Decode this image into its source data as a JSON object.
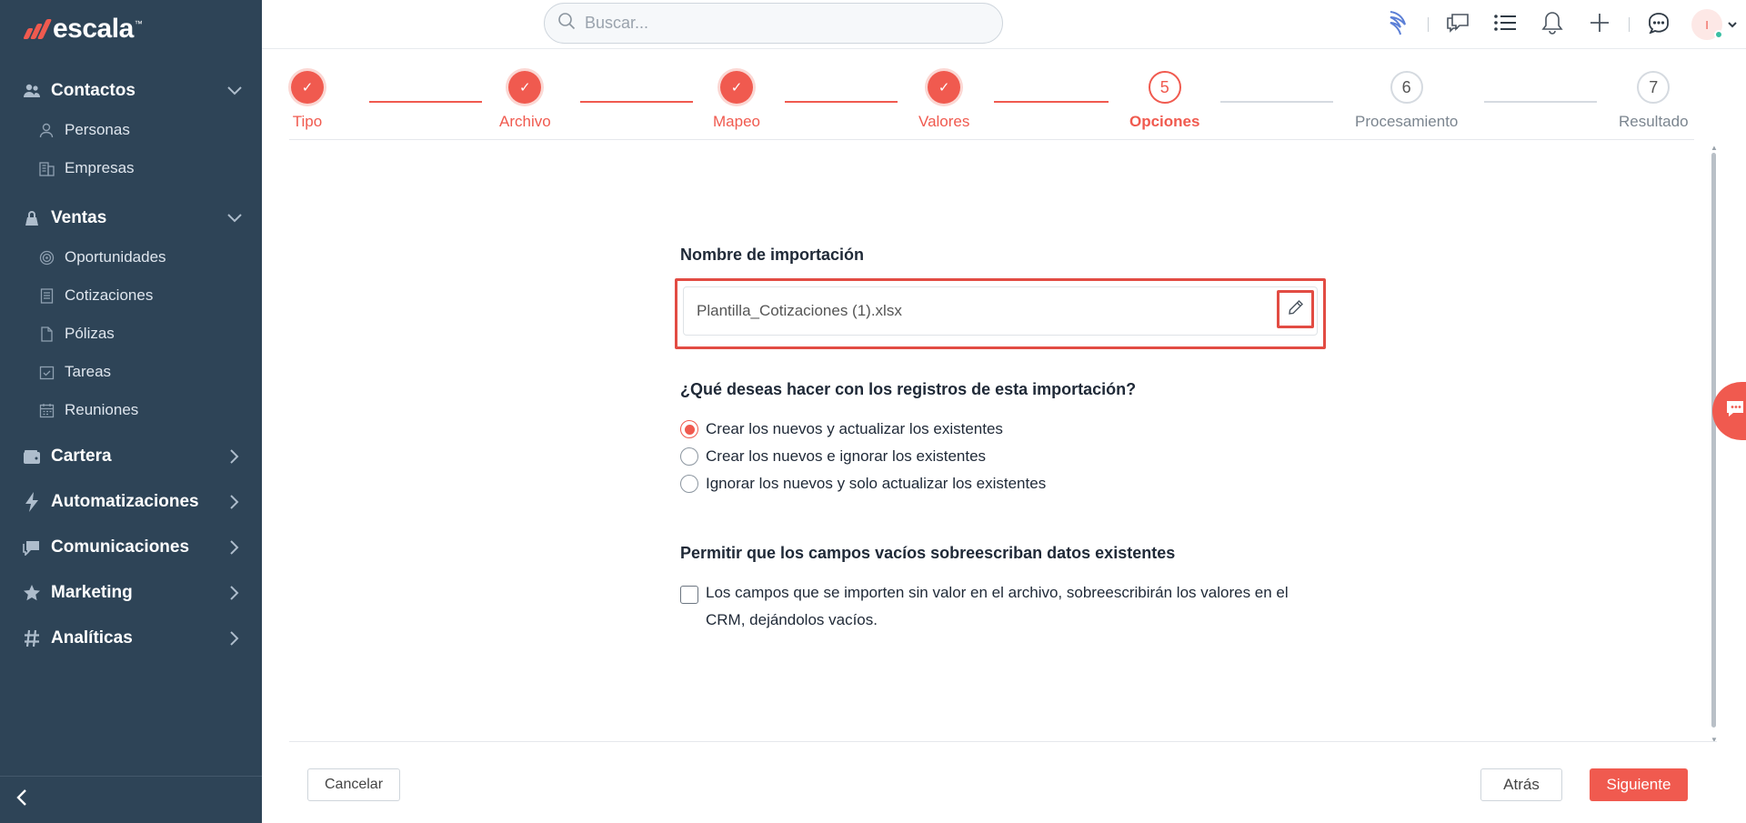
{
  "app": {
    "logo_text": "escala",
    "logo_tm": "™"
  },
  "sidebar": {
    "sections": [
      {
        "label": "Contactos",
        "icon": "contacts-icon",
        "expanded": true,
        "items": [
          {
            "label": "Personas",
            "icon": "person-icon"
          },
          {
            "label": "Empresas",
            "icon": "building-icon"
          }
        ]
      },
      {
        "label": "Ventas",
        "icon": "sales-icon",
        "expanded": true,
        "items": [
          {
            "label": "Oportunidades",
            "icon": "target-icon"
          },
          {
            "label": "Cotizaciones",
            "icon": "document-icon"
          },
          {
            "label": "Pólizas",
            "icon": "file-icon"
          },
          {
            "label": "Tareas",
            "icon": "task-icon"
          },
          {
            "label": "Reuniones",
            "icon": "calendar-icon"
          }
        ]
      },
      {
        "label": "Cartera",
        "icon": "wallet-icon",
        "expanded": false
      },
      {
        "label": "Automatizaciones",
        "icon": "bolt-icon",
        "expanded": false
      },
      {
        "label": "Comunicaciones",
        "icon": "chat-icon",
        "expanded": false
      },
      {
        "label": "Marketing",
        "icon": "star-icon",
        "expanded": false
      },
      {
        "label": "Analíticas",
        "icon": "hash-icon",
        "expanded": false
      }
    ]
  },
  "search": {
    "placeholder": "Buscar..."
  },
  "topbar": {
    "avatar_initial": "I"
  },
  "stepper": {
    "steps": [
      {
        "number": "1",
        "label": "Tipo",
        "state": "done"
      },
      {
        "number": "2",
        "label": "Archivo",
        "state": "done"
      },
      {
        "number": "3",
        "label": "Mapeo",
        "state": "done"
      },
      {
        "number": "4",
        "label": "Valores",
        "state": "done"
      },
      {
        "number": "5",
        "label": "Opciones",
        "state": "active"
      },
      {
        "number": "6",
        "label": "Procesamiento",
        "state": "todo"
      },
      {
        "number": "7",
        "label": "Resultado",
        "state": "todo"
      }
    ],
    "check_glyph": "✓"
  },
  "form": {
    "name_heading": "Nombre de importación",
    "name_value": "Plantilla_Cotizaciones (1).xlsx",
    "records_heading": "¿Qué deseas hacer con los registros de esta importación?",
    "options": [
      {
        "label": "Crear los nuevos y actualizar los existentes",
        "checked": true
      },
      {
        "label": "Crear los nuevos e ignorar los existentes",
        "checked": false
      },
      {
        "label": "Ignorar los nuevos y solo actualizar los existentes",
        "checked": false
      }
    ],
    "overwrite_heading": "Permitir que los campos vacíos sobreescriban datos existentes",
    "overwrite_label": "Los campos que se importen sin valor en el archivo, sobreescribirán los valores en el CRM, dejándolos vacíos.",
    "overwrite_checked": false
  },
  "footer": {
    "cancel_label": "Cancelar",
    "back_label": "Atrás",
    "next_label": "Siguiente"
  },
  "colors": {
    "accent": "#f05a4f",
    "sidebar_bg": "#2e4457"
  }
}
